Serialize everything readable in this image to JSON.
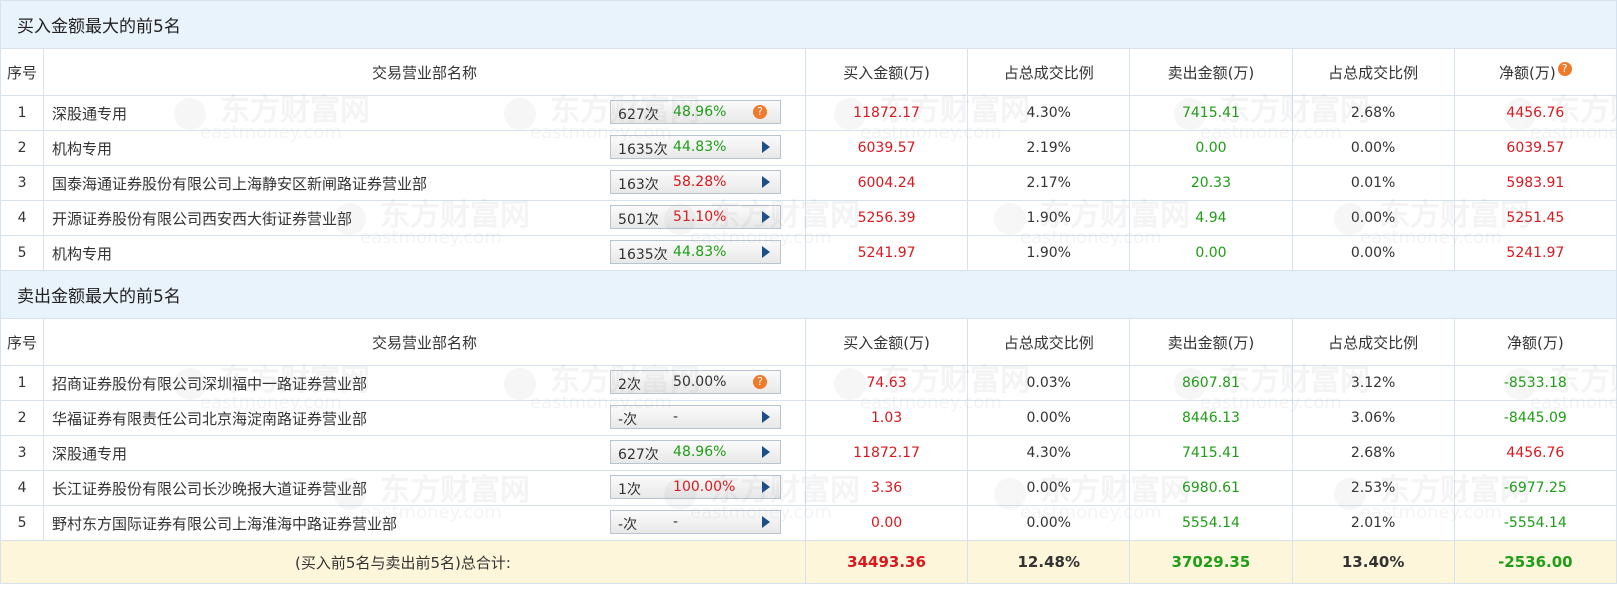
{
  "buy_section": {
    "title": "买入金额最大的前5名",
    "rows": [
      {
        "idx": "1",
        "name": "深股通专用",
        "count": "627次",
        "pct": "48.96%",
        "pct_color": "green",
        "ctrl": "question",
        "buy": "11872.17",
        "buy_ratio": "4.30%",
        "sell": "7415.41",
        "sell_ratio": "2.68%",
        "net": "4456.76",
        "net_color": "red"
      },
      {
        "idx": "2",
        "name": "机构专用",
        "count": "1635次",
        "pct": "44.83%",
        "pct_color": "green",
        "ctrl": "arrow",
        "buy": "6039.57",
        "buy_ratio": "2.19%",
        "sell": "0.00",
        "sell_ratio": "0.00%",
        "net": "6039.57",
        "net_color": "red"
      },
      {
        "idx": "3",
        "name": "国泰海通证券股份有限公司上海静安区新闸路证券营业部",
        "count": "163次",
        "pct": "58.28%",
        "pct_color": "red",
        "ctrl": "arrow",
        "buy": "6004.24",
        "buy_ratio": "2.17%",
        "sell": "20.33",
        "sell_ratio": "0.01%",
        "net": "5983.91",
        "net_color": "red"
      },
      {
        "idx": "4",
        "name": "开源证券股份有限公司西安西大街证券营业部",
        "count": "501次",
        "pct": "51.10%",
        "pct_color": "red",
        "ctrl": "arrow",
        "buy": "5256.39",
        "buy_ratio": "1.90%",
        "sell": "4.94",
        "sell_ratio": "0.00%",
        "net": "5251.45",
        "net_color": "red"
      },
      {
        "idx": "5",
        "name": "机构专用",
        "count": "1635次",
        "pct": "44.83%",
        "pct_color": "green",
        "ctrl": "arrow",
        "buy": "5241.97",
        "buy_ratio": "1.90%",
        "sell": "0.00",
        "sell_ratio": "0.00%",
        "net": "5241.97",
        "net_color": "red"
      }
    ]
  },
  "sell_section": {
    "title": "卖出金额最大的前5名",
    "rows": [
      {
        "idx": "1",
        "name": "招商证券股份有限公司深圳福中一路证券营业部",
        "count": "2次",
        "pct": "50.00%",
        "pct_color": "dark",
        "ctrl": "question",
        "buy": "74.63",
        "buy_ratio": "0.03%",
        "sell": "8607.81",
        "sell_ratio": "3.12%",
        "net": "-8533.18",
        "net_color": "green"
      },
      {
        "idx": "2",
        "name": "华福证券有限责任公司北京海淀南路证券营业部",
        "count": "-次",
        "pct": "-",
        "pct_color": "dark",
        "ctrl": "arrow",
        "buy": "1.03",
        "buy_ratio": "0.00%",
        "sell": "8446.13",
        "sell_ratio": "3.06%",
        "net": "-8445.09",
        "net_color": "green"
      },
      {
        "idx": "3",
        "name": "深股通专用",
        "count": "627次",
        "pct": "48.96%",
        "pct_color": "green",
        "ctrl": "arrow",
        "buy": "11872.17",
        "buy_ratio": "4.30%",
        "sell": "7415.41",
        "sell_ratio": "2.68%",
        "net": "4456.76",
        "net_color": "red"
      },
      {
        "idx": "4",
        "name": "长江证券股份有限公司长沙晚报大道证券营业部",
        "count": "1次",
        "pct": "100.00%",
        "pct_color": "red",
        "ctrl": "arrow",
        "buy": "3.36",
        "buy_ratio": "0.00%",
        "sell": "6980.61",
        "sell_ratio": "2.53%",
        "net": "-6977.25",
        "net_color": "green"
      },
      {
        "idx": "5",
        "name": "野村东方国际证券有限公司上海淮海中路证券营业部",
        "count": "-次",
        "pct": "-",
        "pct_color": "dark",
        "ctrl": "arrow",
        "buy": "0.00",
        "buy_ratio": "0.00%",
        "sell": "5554.14",
        "sell_ratio": "2.01%",
        "net": "-5554.14",
        "net_color": "green"
      }
    ]
  },
  "headers": {
    "idx": "序号",
    "name": "交易营业部名称",
    "buy": "买入金额(万)",
    "buy_ratio": "占总成交比例",
    "sell": "卖出金额(万)",
    "sell_ratio": "占总成交比例",
    "net": "净额(万)"
  },
  "icons": {
    "help": "?"
  },
  "total": {
    "label": "(买入前5名与卖出前5名)总合计:",
    "buy": "34493.36",
    "buy_ratio": "12.48%",
    "sell": "37029.35",
    "sell_ratio": "13.40%",
    "net": "-2536.00"
  },
  "watermark": {
    "brand": "东方财富网",
    "domain": "eastmoney.com"
  },
  "colors": {
    "red": "#d9181e",
    "green": "#1e9e16",
    "header_bg": "#e9f3fc",
    "total_bg": "#fdf6db",
    "help_icon": "#f07a2b",
    "arrow": "#1a4f8a"
  }
}
